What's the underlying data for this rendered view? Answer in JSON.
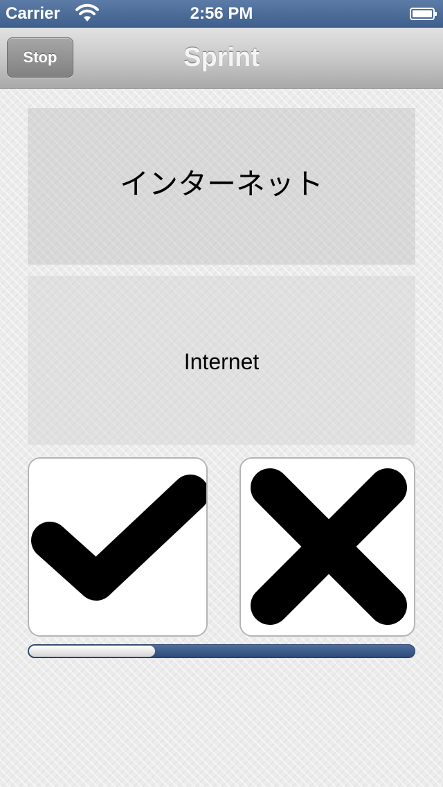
{
  "status_bar": {
    "carrier": "Carrier",
    "time": "2:56 PM",
    "wifi_icon": "wifi-icon",
    "battery_icon": "battery-icon"
  },
  "nav_bar": {
    "stop_label": "Stop",
    "title": "Sprint"
  },
  "flashcard": {
    "word": "インターネット",
    "meaning": "Internet"
  },
  "answer_buttons": {
    "correct_icon": "checkmark-icon",
    "wrong_icon": "cross-icon"
  },
  "progress": {
    "value": 0.33
  },
  "colors": {
    "status_bar": "#4a6a96",
    "progress_track": "#3b5b89",
    "background": "#ececec"
  }
}
